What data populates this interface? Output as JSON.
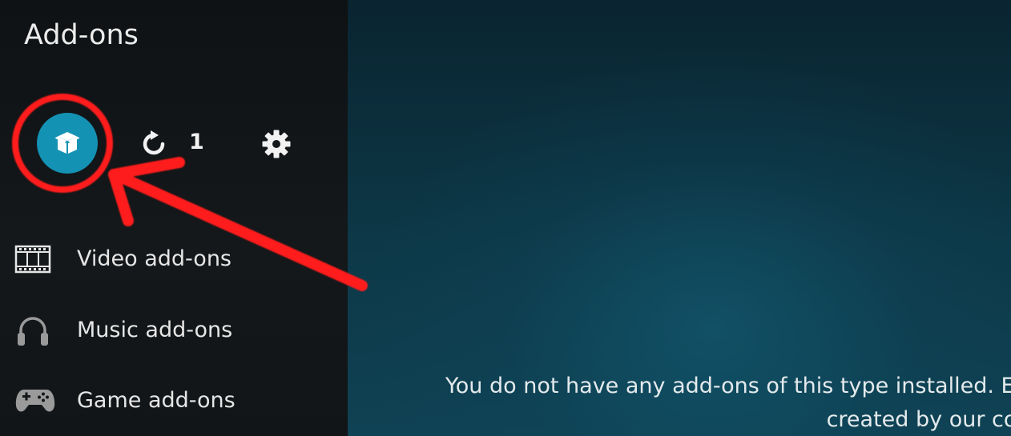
{
  "header": {
    "title": "Add-ons"
  },
  "toolbar": {
    "addon_browser": {
      "icon": "open-box-icon",
      "color": "#1492b4"
    },
    "updates": {
      "icon": "refresh-icon",
      "count": "1"
    },
    "settings": {
      "icon": "gear-icon"
    }
  },
  "menu": {
    "items": [
      {
        "label": "Video add-ons",
        "icon": "film-strip-icon"
      },
      {
        "label": "Music add-ons",
        "icon": "headphones-icon"
      },
      {
        "label": "Game add-ons",
        "icon": "gamepad-icon"
      }
    ]
  },
  "main": {
    "message_line1": "You do not have any add-ons of this type installed. Enter",
    "message_line2": "created by our comm"
  },
  "annotation": {
    "color": "#ff1a1a"
  }
}
